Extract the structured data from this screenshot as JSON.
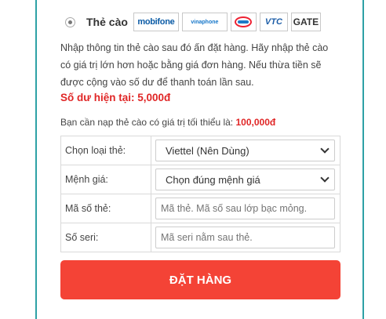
{
  "payment_method": {
    "label": "Thẻ cào",
    "carriers": [
      {
        "name": "mobifone",
        "text": "mobifone"
      },
      {
        "name": "vinaphone",
        "text": "vinaphone"
      },
      {
        "name": "viettel",
        "text": ""
      },
      {
        "name": "vtc",
        "text": "VTC"
      },
      {
        "name": "gate",
        "text": "GATE"
      }
    ]
  },
  "description": "Nhập thông tin thẻ cào sau đó ấn đặt hàng. Hãy nhập thẻ cào có giá trị lớn hơn hoặc bằng giá đơn hàng. Nếu thừa tiền sẽ được cộng vào số dư để thanh toán lần sau.",
  "balance": "Số dư hiện tại: 5,000đ",
  "min_note": {
    "text": "Bạn cần nạp thẻ cào có giá trị tối thiểu là: ",
    "amount": "100,000đ"
  },
  "form": {
    "card_type": {
      "label": "Chọn loại thẻ:",
      "value": "Viettel (Nên Dùng)"
    },
    "denomination": {
      "label": "Mệnh giá:",
      "value": "Chọn đúng mệnh giá"
    },
    "card_code": {
      "label": "Mã số thẻ:",
      "placeholder": "Mã thẻ. Mã số sau lớp bạc mỏng."
    },
    "serial": {
      "label": "Số seri:",
      "placeholder": "Mã seri nằm sau thẻ."
    }
  },
  "submit_label": "ĐẶT HÀNG",
  "colors": {
    "accent_red": "#f44336",
    "balance_red": "#e02626",
    "panel_border": "#2ea1a6"
  }
}
